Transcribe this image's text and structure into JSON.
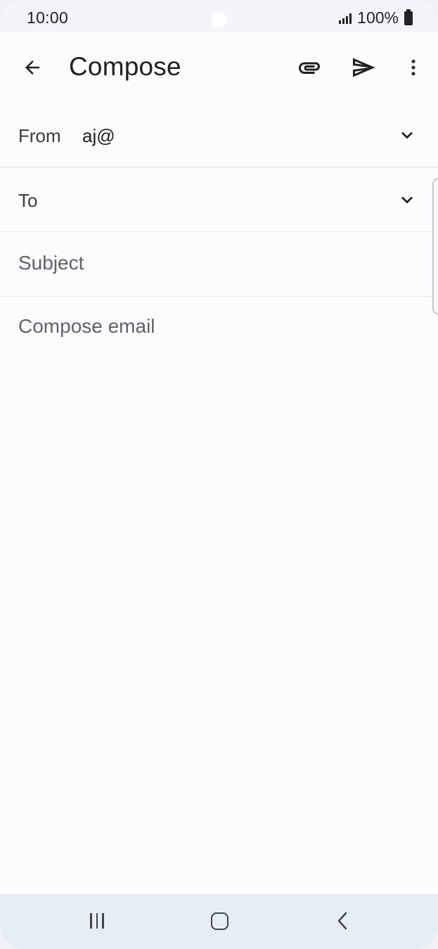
{
  "status_bar": {
    "time": "10:00",
    "battery_text": "100%",
    "icons": [
      "signal-icon",
      "battery-icon"
    ]
  },
  "app_bar": {
    "title": "Compose",
    "icons": [
      "back-arrow-icon",
      "paperclip-icon",
      "send-icon",
      "more-vert-icon"
    ]
  },
  "fields": {
    "from_label": "From",
    "from_value": "aj@",
    "to_label": "To",
    "subject_placeholder": "Subject",
    "body_placeholder": "Compose email"
  },
  "nav_bar": {
    "icons": [
      "recents-icon",
      "home-icon",
      "nav-back-icon"
    ]
  },
  "colors": {
    "background": "#fcfcff",
    "nav_bar": "#e5edf5",
    "text_primary": "#1f1f1f",
    "placeholder": "#5f6368"
  }
}
